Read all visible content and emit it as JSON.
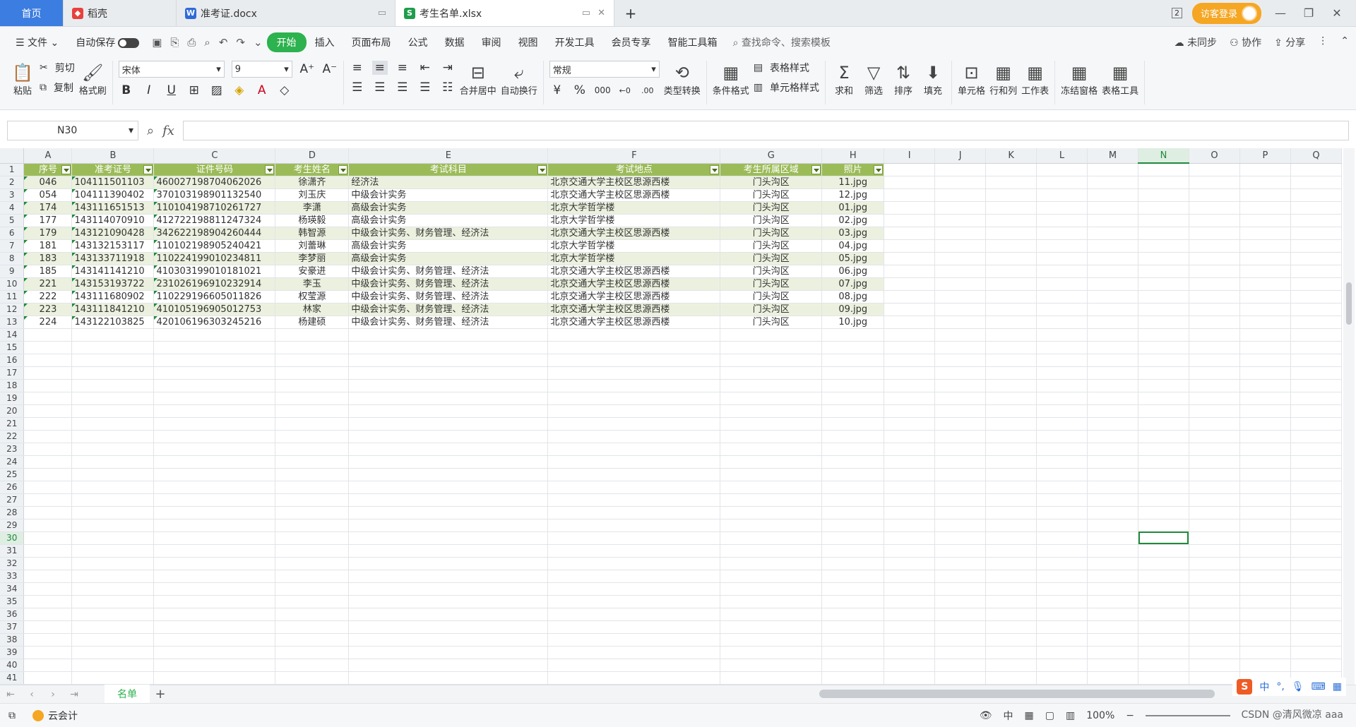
{
  "tabs": {
    "home": "首页",
    "doc": "稻壳",
    "docx": "准考证.docx",
    "xlsx": "考生名单.xlsx",
    "new": "+"
  },
  "titlebar": {
    "page_count": "2",
    "login": "访客登录"
  },
  "menu": {
    "file": "文件",
    "autosave": "自动保存",
    "items": [
      "开始",
      "插入",
      "页面布局",
      "公式",
      "数据",
      "审阅",
      "视图",
      "开发工具",
      "会员专享",
      "智能工具箱"
    ],
    "search": "查找命令、搜索模板",
    "sync": "未同步",
    "collab": "协作",
    "share": "分享"
  },
  "ribbon": {
    "paste": "粘贴",
    "cut": "剪切",
    "copy": "复制",
    "format_painter": "格式刷",
    "font": "宋体",
    "size": "9",
    "merge": "合并居中",
    "wrap": "自动换行",
    "numfmt": "常规",
    "convert": "类型转换",
    "cond_format": "条件格式",
    "table_style": "表格样式",
    "cell_style": "单元格样式",
    "sum": "求和",
    "filter": "筛选",
    "sort": "排序",
    "fill": "填充",
    "cell": "单元格",
    "rowcol": "行和列",
    "worksheet": "工作表",
    "freeze": "冻结窗格",
    "tabletool": "表格工具"
  },
  "formula": {
    "namebox": "N30",
    "fx": "fx",
    "content": ""
  },
  "columns": [
    "A",
    "B",
    "C",
    "D",
    "E",
    "F",
    "G",
    "H",
    "I",
    "J",
    "K",
    "L",
    "M",
    "N",
    "O",
    "P",
    "Q"
  ],
  "header_row": [
    "序号",
    "准考证号",
    "证件号码",
    "考生姓名",
    "考试科目",
    "考试地点",
    "考生所属区域",
    "照片"
  ],
  "rows": [
    [
      "046",
      "104111501103",
      "460027198704062026",
      "徐潇齐",
      "经济法",
      "北京交通大学主校区思源西楼",
      "门头沟区",
      "11.jpg"
    ],
    [
      "054",
      "104111390402",
      "370103198901132540",
      "刘玉庆",
      "中级会计实务",
      "北京交通大学主校区思源西楼",
      "门头沟区",
      "12.jpg"
    ],
    [
      "174",
      "143111651513",
      "110104198710261727",
      "李潇",
      "高级会计实务",
      "北京大学哲学楼",
      "门头沟区",
      "01.jpg"
    ],
    [
      "177",
      "143114070910",
      "412722198811247324",
      "杨瑛毅",
      "高级会计实务",
      "北京大学哲学楼",
      "门头沟区",
      "02.jpg"
    ],
    [
      "179",
      "143121090428",
      "342622198904260444",
      "韩智源",
      "中级会计实务、财务管理、经济法",
      "北京交通大学主校区思源西楼",
      "门头沟区",
      "03.jpg"
    ],
    [
      "181",
      "143132153117",
      "110102198905240421",
      "刘蕾琳",
      "高级会计实务",
      "北京大学哲学楼",
      "门头沟区",
      "04.jpg"
    ],
    [
      "183",
      "143133711918",
      "110224199010234811",
      "李梦丽",
      "高级会计实务",
      "北京大学哲学楼",
      "门头沟区",
      "05.jpg"
    ],
    [
      "185",
      "143141141210",
      "410303199010181021",
      "安豪进",
      "中级会计实务、财务管理、经济法",
      "北京交通大学主校区思源西楼",
      "门头沟区",
      "06.jpg"
    ],
    [
      "221",
      "143153193722",
      "231026196910232914",
      "李玉",
      "中级会计实务、财务管理、经济法",
      "北京交通大学主校区思源西楼",
      "门头沟区",
      "07.jpg"
    ],
    [
      "222",
      "143111680902",
      "110229196605011826",
      "权莹源",
      "中级会计实务、财务管理、经济法",
      "北京交通大学主校区思源西楼",
      "门头沟区",
      "08.jpg"
    ],
    [
      "223",
      "143111841210",
      "410105196905012753",
      "林家",
      "中级会计实务、财务管理、经济法",
      "北京交通大学主校区思源西楼",
      "门头沟区",
      "09.jpg"
    ],
    [
      "224",
      "143122103825",
      "420106196303245216",
      "杨建硕",
      "中级会计实务、财务管理、经济法",
      "北京交通大学主校区思源西楼",
      "门头沟区",
      "10.jpg"
    ]
  ],
  "total_rows": 41,
  "selected": {
    "col": "N",
    "row": 30
  },
  "sheets": [
    "名单"
  ],
  "status": {
    "cloud": "云会计",
    "lang": "中",
    "zoom": "100%",
    "watermark": "CSDN @清风微凉 aaa"
  },
  "ime": {
    "logo": "S",
    "mode": "中"
  },
  "colors": {
    "header_green": "#9bbb59",
    "band_green": "#ebf1de",
    "accent": "#2cb24e"
  }
}
